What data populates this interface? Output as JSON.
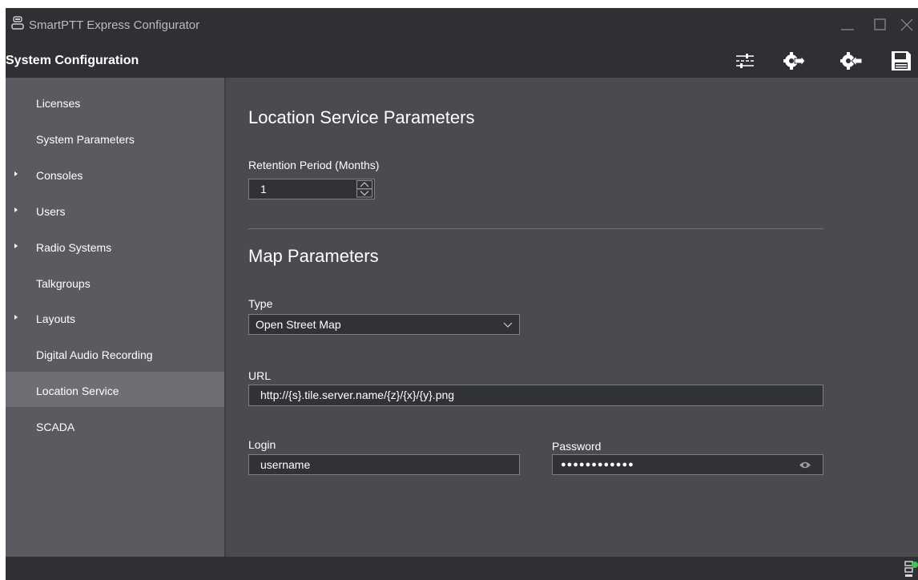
{
  "window": {
    "app_title": "SmartPTT Express Configurator"
  },
  "header": {
    "title": "System Configuration",
    "tools": [
      "settings-sliders-icon",
      "export-config-icon",
      "import-config-icon",
      "save-icon"
    ]
  },
  "sidebar": {
    "items": [
      {
        "label": "Licenses",
        "expandable": false,
        "active": false
      },
      {
        "label": "System Parameters",
        "expandable": false,
        "active": false
      },
      {
        "label": "Consoles",
        "expandable": true,
        "active": false
      },
      {
        "label": "Users",
        "expandable": true,
        "active": false
      },
      {
        "label": "Radio Systems",
        "expandable": true,
        "active": false
      },
      {
        "label": "Talkgroups",
        "expandable": false,
        "active": false
      },
      {
        "label": "Layouts",
        "expandable": true,
        "active": false
      },
      {
        "label": "Digital Audio Recording",
        "expandable": false,
        "active": false
      },
      {
        "label": "Location Service",
        "expandable": false,
        "active": true
      },
      {
        "label": "SCADA",
        "expandable": false,
        "active": false
      }
    ]
  },
  "main": {
    "location_section_title": "Location Service Parameters",
    "retention": {
      "label": "Retention Period (Months)",
      "value": "1"
    },
    "map_section_title": "Map Parameters",
    "type": {
      "label": "Type",
      "value": "Open Street Map"
    },
    "url": {
      "label": "URL",
      "value": "http://{s}.tile.server.name/{z}/{x}/{y}.png"
    },
    "login": {
      "label": "Login",
      "value": "username"
    },
    "password": {
      "label": "Password",
      "masked_value": "●●●●●●●●●●●●"
    }
  },
  "colors": {
    "titlebar": "#2f3034",
    "sidebar": "#5a5a60",
    "sidebar_active": "#6e6e74",
    "content": "#4a4a4f",
    "status_ok": "#3cc35a"
  }
}
